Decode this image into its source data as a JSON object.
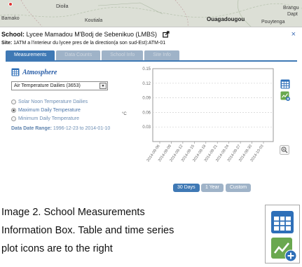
{
  "map": {
    "labels": [
      "Bamako",
      "Dioila",
      "Koutiala",
      "Ouagadougou",
      "Pouytenga",
      "Brangu",
      "Dapt"
    ]
  },
  "info_box": {
    "school_label": "School:",
    "school_name": "Lycee Mamadou M'Bodj de Sebenikuo (LMBS)",
    "site_label": "Site:",
    "site_name": "1ATM a l'interieur du lycee pres de la direction(a son sud-Est):ATM-01",
    "close_label": "×",
    "tabs": [
      {
        "label": "Measurements",
        "active": true
      },
      {
        "label": "Data Counts",
        "active": false
      },
      {
        "label": "School Info",
        "active": false
      },
      {
        "label": "Site Info",
        "active": false
      }
    ],
    "dataset_title": "Atmosphere",
    "dataset_select": "Air Temperature Dailies (3653)",
    "radio_options": [
      {
        "label": "Solar Noon Temperature Dailies",
        "checked": false
      },
      {
        "label": "Maximum Daily Temperature",
        "checked": true
      },
      {
        "label": "Minimum Daily Temperature",
        "checked": false
      }
    ],
    "date_range_label": "Data Date Range:",
    "date_range_value": "1996-12-23 to 2014-01-10",
    "range_buttons": [
      {
        "label": "30 Days",
        "active": true
      },
      {
        "label": "1 Year",
        "active": false
      },
      {
        "label": "Custom",
        "active": false
      }
    ]
  },
  "chart_data": {
    "type": "line",
    "xlabel": "",
    "ylabel": "°C",
    "ylim": [
      0,
      0.15
    ],
    "y_ticks": [
      "0.15",
      "0.12",
      "0.09",
      "0.06",
      "0.03",
      "0"
    ],
    "x_ticks": [
      "2014-09-06",
      "2014-09-09",
      "2014-09-12",
      "2014-09-15",
      "2014-09-18",
      "2014-09-21",
      "2014-09-24",
      "2014-09-27",
      "2014-09-30",
      "2014-10-03"
    ],
    "grid": true,
    "series": []
  },
  "caption": {
    "lines": [
      "Image 2. School Measurements",
      "Information Box. Table and time series",
      "plot icons are to the right"
    ]
  },
  "colors": {
    "accent": "#3f79b5",
    "tab_inactive": "#9fb3c8",
    "table_icon": "#2e6fb8",
    "plot_icon": "#6aa84f"
  }
}
